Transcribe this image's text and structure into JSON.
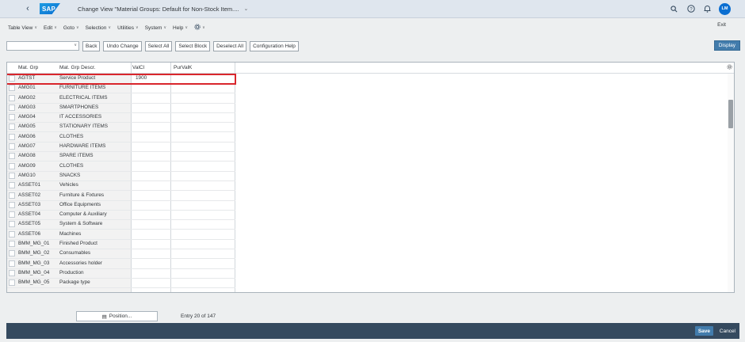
{
  "shell": {
    "title": "Change View \"Material Groups: Default for Non-Stock Item....",
    "avatar": "LM"
  },
  "menu": [
    "Table View",
    "Edit",
    "Goto",
    "Selection",
    "Utilities",
    "System",
    "Help"
  ],
  "exit_label": "Exit",
  "toolbar": {
    "back": "Back",
    "undo": "Undo Change",
    "select_all": "Select All",
    "select_block": "Select Block",
    "deselect_all": "Deselect All",
    "config_help": "Configuration Help",
    "display": "Display"
  },
  "table": {
    "headers": [
      "Mat. Grp",
      "Mat. Grp Descr.",
      "ValCl",
      "PurValK"
    ],
    "rows": [
      {
        "grp": "AGTST",
        "descr": "Service Product",
        "valcl": "1900",
        "purvalk": ""
      },
      {
        "grp": "AMG01",
        "descr": "FURNITURE ITEMS",
        "valcl": "",
        "purvalk": ""
      },
      {
        "grp": "AMG02",
        "descr": "ELECTRICAL ITEMS",
        "valcl": "",
        "purvalk": ""
      },
      {
        "grp": "AMG03",
        "descr": "SMARTPHONES",
        "valcl": "",
        "purvalk": ""
      },
      {
        "grp": "AMG04",
        "descr": "IT ACCESSORIES",
        "valcl": "",
        "purvalk": ""
      },
      {
        "grp": "AMG05",
        "descr": "STATIONARY ITEMS",
        "valcl": "",
        "purvalk": ""
      },
      {
        "grp": "AMG06",
        "descr": "CLOTHES",
        "valcl": "",
        "purvalk": ""
      },
      {
        "grp": "AMG07",
        "descr": "HARDWARE ITEMS",
        "valcl": "",
        "purvalk": ""
      },
      {
        "grp": "AMG08",
        "descr": "SPARE ITEMS",
        "valcl": "",
        "purvalk": ""
      },
      {
        "grp": "AMG09",
        "descr": "CLOTHES",
        "valcl": "",
        "purvalk": ""
      },
      {
        "grp": "AMG10",
        "descr": "SNACKS",
        "valcl": "",
        "purvalk": ""
      },
      {
        "grp": "ASSET01",
        "descr": "Vehicles",
        "valcl": "",
        "purvalk": ""
      },
      {
        "grp": "ASSET02",
        "descr": "Furniture & Fixtures",
        "valcl": "",
        "purvalk": ""
      },
      {
        "grp": "ASSET03",
        "descr": "Office Equipments",
        "valcl": "",
        "purvalk": ""
      },
      {
        "grp": "ASSET04",
        "descr": "Computer & Auxiliary",
        "valcl": "",
        "purvalk": ""
      },
      {
        "grp": "ASSET05",
        "descr": "System & Software",
        "valcl": "",
        "purvalk": ""
      },
      {
        "grp": "ASSET06",
        "descr": "Machines",
        "valcl": "",
        "purvalk": ""
      },
      {
        "grp": "BMM_MG_01",
        "descr": "Finished Product",
        "valcl": "",
        "purvalk": ""
      },
      {
        "grp": "BMM_MG_02",
        "descr": "Consumables",
        "valcl": "",
        "purvalk": ""
      },
      {
        "grp": "BMM_MG_03",
        "descr": "Accessories holder",
        "valcl": "",
        "purvalk": ""
      },
      {
        "grp": "BMM_MG_04",
        "descr": "Production",
        "valcl": "",
        "purvalk": ""
      },
      {
        "grp": "BMM_MG_05",
        "descr": "Package type",
        "valcl": "",
        "purvalk": ""
      }
    ]
  },
  "footer": {
    "position": "Position...",
    "entry": "Entry 20 of 147",
    "save": "Save",
    "cancel": "Cancel"
  },
  "colors": {
    "shell_bg": "#dfe6ee",
    "footer_bg": "#354a5f",
    "accent": "#427cac",
    "highlight": "#d9262c"
  }
}
